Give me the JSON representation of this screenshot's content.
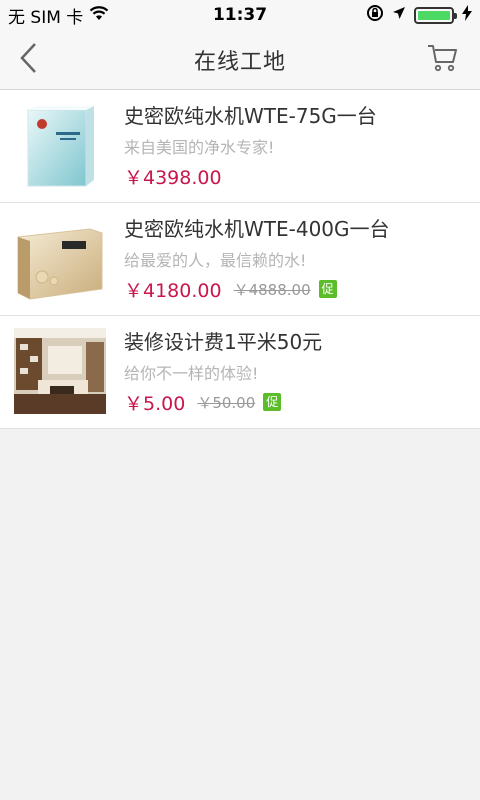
{
  "status": {
    "carrier": "无 SIM 卡",
    "time": "11:37",
    "battery_level": 1.0,
    "wifi_icon": "wifi-icon",
    "location_icon": "location-arrow-icon",
    "lock_icon": "rotation-lock-icon",
    "charging_icon": "charging-bolt-icon"
  },
  "nav": {
    "title": "在线工地",
    "back_icon": "chevron-left-icon",
    "cart_icon": "cart-icon"
  },
  "products": [
    {
      "name": "史密欧纯水机WTE-75G一台",
      "slogan": "来自美国的净水专家!",
      "price": "￥4398.00",
      "old_price": "",
      "promo": ""
    },
    {
      "name": "史密欧纯水机WTE-400G一台",
      "slogan": "给最爱的人，最信赖的水!",
      "price": "￥4180.00",
      "old_price": "￥4888.00",
      "promo": "促"
    },
    {
      "name": "装修设计费1平米50元",
      "slogan": "给你不一样的体验!",
      "price": "￥5.00",
      "old_price": "￥50.00",
      "promo": "促"
    }
  ],
  "colors": {
    "price": "#c9174c",
    "promo_badge": "#5bbd2a",
    "battery": "#4cd964"
  }
}
